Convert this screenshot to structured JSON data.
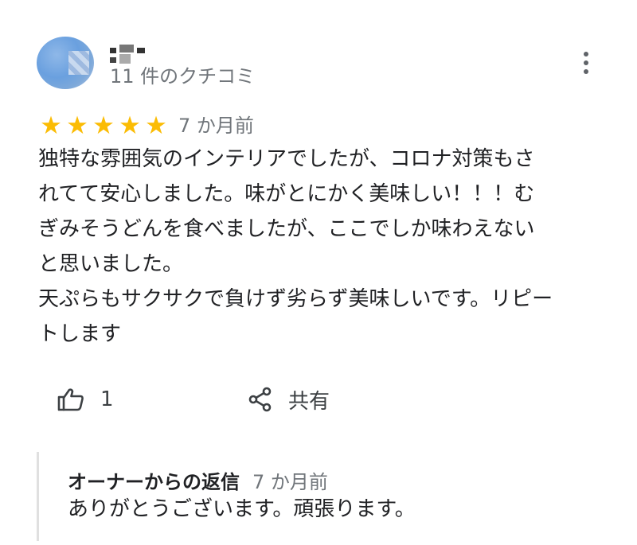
{
  "reviewer": {
    "review_count": "11 件のクチコミ"
  },
  "review": {
    "rating": 5,
    "rating_max": 5,
    "stars": [
      "★",
      "★",
      "★",
      "★",
      "★"
    ],
    "date": "7 か月前",
    "text": "独特な雰囲気のインテリアでしたが、コロナ対策もさ\nれてて安心しました。味がとにかく美味しい！！！む\nぎみそうどんを食べましたが、ここでしか味わえない\nと思いました。\n天ぷらもサクサクで負けず劣らず美味しいです。リピー\nトします"
  },
  "actions": {
    "like_count": "1",
    "share_label": "共有"
  },
  "owner_reply": {
    "title": "オーナーからの返信",
    "date": "7 か月前",
    "text": "ありがとうございます。頑張ります。"
  },
  "icons": {
    "avatar": "avatar-image",
    "more": "more-vert-icon",
    "like": "thumb-up-icon",
    "share": "share-icon"
  },
  "colors": {
    "star": "#fbbc04",
    "secondary_text": "#70757a",
    "primary_text": "#202124"
  }
}
